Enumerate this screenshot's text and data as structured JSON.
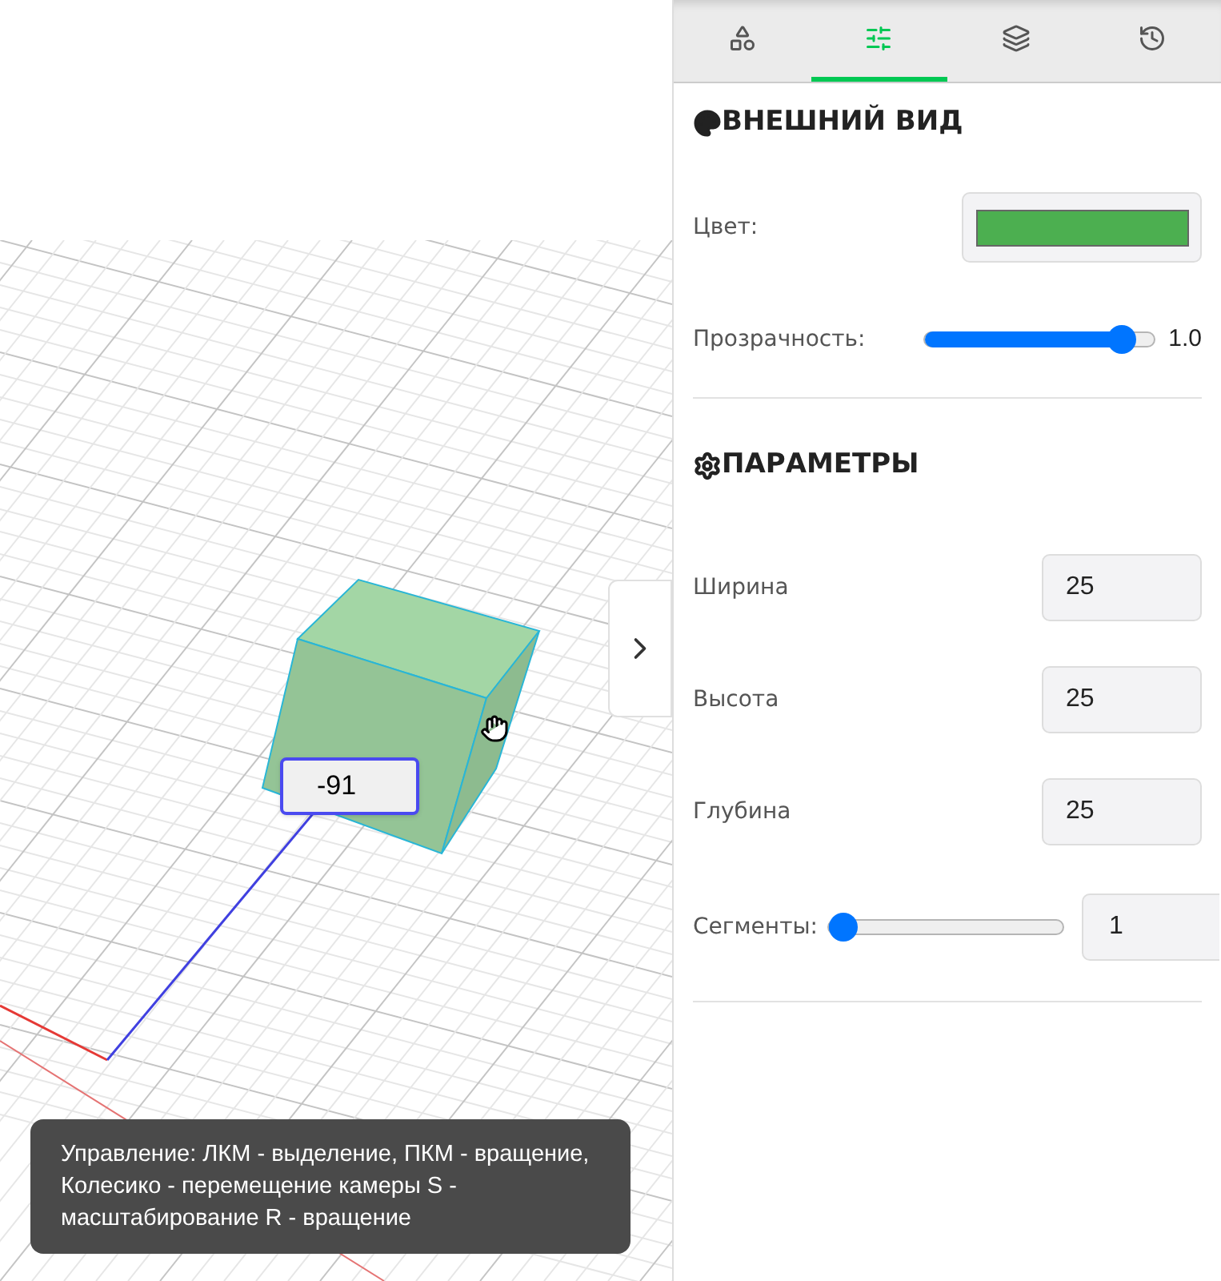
{
  "viewport": {
    "dimension_input": {
      "value": "-91"
    },
    "help_text": "Управление: ЛКМ - выделение, ПКМ - вращение, Колесико - перемещение камеры S - масштабирование R - вращение"
  },
  "tabs": [
    {
      "kind": "shapes",
      "selected": false
    },
    {
      "kind": "sliders",
      "selected": true
    },
    {
      "kind": "layers",
      "selected": false
    },
    {
      "kind": "history",
      "selected": false
    }
  ],
  "appearance": {
    "title": "ВНЕШНИЙ ВИД",
    "color_label": "Цвет:",
    "color": "#4caf50",
    "opacity": {
      "label": "Прозрачность:",
      "level": 0.88,
      "reading": "1.0"
    }
  },
  "parameters": {
    "title": "ПАРАМЕТРЫ",
    "fields": [
      {
        "label": "Ширина",
        "value": "25"
      },
      {
        "label": "Высота",
        "value": "25"
      },
      {
        "label": "Глубина",
        "value": "25"
      }
    ],
    "segments": {
      "label": "Сегменты:",
      "level": 0,
      "value": "1"
    }
  }
}
